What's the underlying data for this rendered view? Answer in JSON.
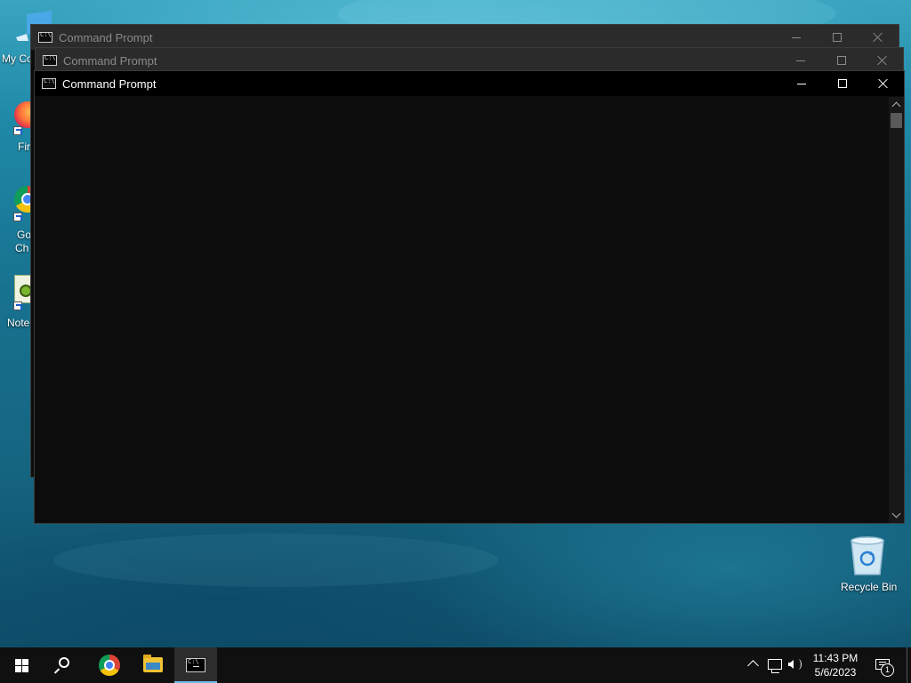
{
  "desktop": {
    "icons": [
      {
        "id": "my-computer",
        "label": "My Co"
      },
      {
        "id": "firefox",
        "label": "Fir"
      },
      {
        "id": "chrome",
        "label_line1": "Go",
        "label_line2": "Ch"
      },
      {
        "id": "notepad",
        "label": "Note"
      },
      {
        "id": "recycle-bin",
        "label": "Recycle Bin"
      }
    ]
  },
  "windows": [
    {
      "title": "Command Prompt",
      "state": "inactive"
    },
    {
      "title": "Command Prompt",
      "state": "inactive"
    },
    {
      "title": "Command Prompt",
      "state": "active"
    }
  ],
  "taskbar": {
    "items": [
      "windows-start",
      "search",
      "google-chrome",
      "file-explorer",
      "command-prompt"
    ],
    "clock": {
      "time": "11:43 PM",
      "date": "5/6/2023"
    },
    "notification_count": "1"
  },
  "colors": {
    "console_bg": "#0c0c0c",
    "active_titlebar": "#000000",
    "inactive_titlebar": "#2b2b2b",
    "taskbar_bg": "#101010",
    "accent": "#76b9ed"
  }
}
